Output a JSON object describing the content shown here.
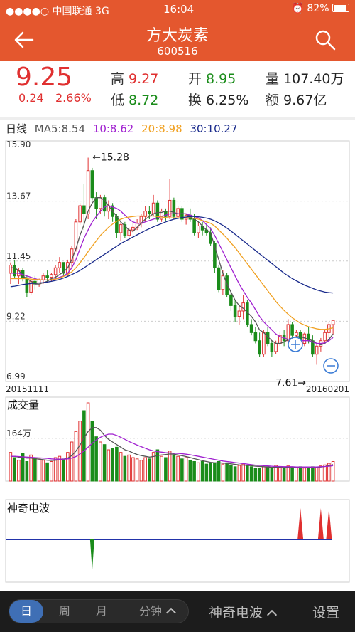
{
  "status": {
    "carrier": "●●●●○ 中国联通",
    "network": "3G",
    "time": "16:04",
    "battery": "82%"
  },
  "nav": {
    "title": "方大炭素",
    "code": "600516"
  },
  "quote": {
    "price": "9.25",
    "change": "0.24",
    "change_pct": "2.66%",
    "high_label": "高",
    "high": "9.27",
    "open_label": "开",
    "open": "8.95",
    "volume_label": "量",
    "volume": "107.40万",
    "low_label": "低",
    "low": "8.72",
    "turnover_label": "换",
    "turnover": "6.25%",
    "amount_label": "额",
    "amount": "9.67亿"
  },
  "ma_bar": {
    "period": "日线",
    "ma5": "MA5:8.54",
    "ma10": "10:8.62",
    "ma20": "20:8.98",
    "ma30": "30:10.27"
  },
  "colors": {
    "accent": "#e4572e",
    "up": "#e03030",
    "down": "#1a8c1a",
    "ma5": "#555555",
    "ma10": "#a020d0",
    "ma20": "#f0a020",
    "ma30": "#1a2b8c",
    "wave": "#2233aa"
  },
  "chart_data": [
    {
      "type": "candlestick",
      "title": "日线",
      "y_ticks": [
        "15.90",
        "13.67",
        "11.45",
        "9.22",
        "6.99"
      ],
      "ylim": [
        6.99,
        15.9
      ],
      "x_start_label": "20151111",
      "x_end_label": "20160201",
      "annotations": [
        {
          "text": "←15.28",
          "value": 15.28
        },
        {
          "text": "7.61→",
          "value": 7.61
        }
      ],
      "candles": [
        [
          11.0,
          11.4,
          10.6,
          11.3
        ],
        [
          11.3,
          11.5,
          10.8,
          10.9
        ],
        [
          10.9,
          11.2,
          10.6,
          11.1
        ],
        [
          11.1,
          11.2,
          10.7,
          10.8
        ],
        [
          10.8,
          10.9,
          10.1,
          10.3
        ],
        [
          10.3,
          10.8,
          10.2,
          10.7
        ],
        [
          10.7,
          10.9,
          10.4,
          10.6
        ],
        [
          10.6,
          10.8,
          10.5,
          10.75
        ],
        [
          10.75,
          11.0,
          10.6,
          10.9
        ],
        [
          10.9,
          11.1,
          10.7,
          10.85
        ],
        [
          10.85,
          11.0,
          10.7,
          10.95
        ],
        [
          10.95,
          11.3,
          10.8,
          11.2
        ],
        [
          11.2,
          11.6,
          11.0,
          11.4
        ],
        [
          11.4,
          11.4,
          10.9,
          11.0
        ],
        [
          11.0,
          11.5,
          10.9,
          11.4
        ],
        [
          11.4,
          12.0,
          11.2,
          11.9
        ],
        [
          11.9,
          13.0,
          11.8,
          12.9
        ],
        [
          12.9,
          13.6,
          12.8,
          13.5
        ],
        [
          13.5,
          14.3,
          12.6,
          13.2
        ],
        [
          13.2,
          15.28,
          13.0,
          14.8
        ],
        [
          14.8,
          14.9,
          13.7,
          13.8
        ],
        [
          13.8,
          14.0,
          13.0,
          13.4
        ],
        [
          13.4,
          13.9,
          13.2,
          13.8
        ],
        [
          13.8,
          13.9,
          13.1,
          13.3
        ],
        [
          13.3,
          13.7,
          13.0,
          13.5
        ],
        [
          13.5,
          13.6,
          12.9,
          13.1
        ],
        [
          13.1,
          13.2,
          12.3,
          12.5
        ],
        [
          12.5,
          12.9,
          12.2,
          12.8
        ],
        [
          12.8,
          12.9,
          12.3,
          12.4
        ],
        [
          12.4,
          12.7,
          12.2,
          12.6
        ],
        [
          12.6,
          12.9,
          12.5,
          12.7
        ],
        [
          12.7,
          13.0,
          12.6,
          12.85
        ],
        [
          12.85,
          13.2,
          12.7,
          13.1
        ],
        [
          13.1,
          13.5,
          12.9,
          13.3
        ],
        [
          13.3,
          13.5,
          13.0,
          13.2
        ],
        [
          13.2,
          13.9,
          13.1,
          13.6
        ],
        [
          13.6,
          13.7,
          12.9,
          13.0
        ],
        [
          13.0,
          13.4,
          12.9,
          13.3
        ],
        [
          13.3,
          13.4,
          12.95,
          13.1
        ],
        [
          13.1,
          14.5,
          13.0,
          13.7
        ],
        [
          13.7,
          13.8,
          13.0,
          13.1
        ],
        [
          13.1,
          13.5,
          13.0,
          13.4
        ],
        [
          13.4,
          13.5,
          12.9,
          13.0
        ],
        [
          13.0,
          13.2,
          12.8,
          13.15
        ],
        [
          13.15,
          13.4,
          12.9,
          13.0
        ],
        [
          13.0,
          13.2,
          12.4,
          12.5
        ],
        [
          12.5,
          12.9,
          12.3,
          12.75
        ],
        [
          12.75,
          12.9,
          12.4,
          12.6
        ],
        [
          12.6,
          12.8,
          12.4,
          12.5
        ],
        [
          12.5,
          12.7,
          12.0,
          12.1
        ],
        [
          12.1,
          12.2,
          11.0,
          11.2
        ],
        [
          11.2,
          11.3,
          10.3,
          10.4
        ],
        [
          10.4,
          11.1,
          10.2,
          10.9
        ],
        [
          10.9,
          11.0,
          10.1,
          10.2
        ],
        [
          10.2,
          10.4,
          9.6,
          9.8
        ],
        [
          9.8,
          10.0,
          9.2,
          9.4
        ],
        [
          9.4,
          9.8,
          9.1,
          9.6
        ],
        [
          9.6,
          10.2,
          9.3,
          9.9
        ],
        [
          9.9,
          10.0,
          9.0,
          9.1
        ],
        [
          9.1,
          9.3,
          8.7,
          8.8
        ],
        [
          8.8,
          9.0,
          8.4,
          8.5
        ],
        [
          8.5,
          8.8,
          7.9,
          8.0
        ],
        [
          8.0,
          8.9,
          7.9,
          8.8
        ],
        [
          8.8,
          9.0,
          8.3,
          8.4
        ],
        [
          8.4,
          8.5,
          7.9,
          8.1
        ],
        [
          8.1,
          8.5,
          8.0,
          8.4
        ],
        [
          8.4,
          8.8,
          8.3,
          8.7
        ],
        [
          8.7,
          8.9,
          8.3,
          8.5
        ],
        [
          8.5,
          9.3,
          8.4,
          9.1
        ],
        [
          9.1,
          9.2,
          8.6,
          8.7
        ],
        [
          8.7,
          8.9,
          8.4,
          8.8
        ],
        [
          8.8,
          8.9,
          8.3,
          8.4
        ],
        [
          8.4,
          8.8,
          8.3,
          8.75
        ],
        [
          8.75,
          9.0,
          8.4,
          8.5
        ],
        [
          8.5,
          8.7,
          7.9,
          8.0
        ],
        [
          8.0,
          8.4,
          7.61,
          8.3
        ],
        [
          8.3,
          8.6,
          8.1,
          8.5
        ],
        [
          8.5,
          8.9,
          8.4,
          8.8
        ],
        [
          8.8,
          9.2,
          8.6,
          9.1
        ],
        [
          9.1,
          9.27,
          8.72,
          9.25
        ]
      ],
      "ma5": [
        11.2,
        11.2,
        11.1,
        10.9,
        10.8,
        10.7,
        10.6,
        10.6,
        10.65,
        10.7,
        10.8,
        10.85,
        10.95,
        11.05,
        11.2,
        11.5,
        11.9,
        12.4,
        12.8,
        13.3,
        13.6,
        13.8,
        13.8,
        13.7,
        13.5,
        13.3,
        13.1,
        12.9,
        12.75,
        12.6,
        12.55,
        12.7,
        12.85,
        13.0,
        13.1,
        13.2,
        13.25,
        13.25,
        13.3,
        13.3,
        13.25,
        13.2,
        13.2,
        13.2,
        13.1,
        13.0,
        12.9,
        12.75,
        12.6,
        12.5,
        12.0,
        11.5,
        11.0,
        10.6,
        10.3,
        10.0,
        9.8,
        9.7,
        9.55,
        9.4,
        9.2,
        8.9,
        8.8,
        8.65,
        8.5,
        8.4,
        8.4,
        8.45,
        8.55,
        8.6,
        8.65,
        8.65,
        8.6,
        8.55,
        8.5,
        8.4,
        8.35,
        8.4,
        8.55,
        8.75
      ],
      "ma10": [
        11.0,
        11.0,
        11.0,
        10.95,
        10.9,
        10.85,
        10.8,
        10.75,
        10.75,
        10.75,
        10.75,
        10.8,
        10.85,
        10.9,
        11.0,
        11.2,
        11.5,
        11.9,
        12.3,
        12.6,
        12.9,
        13.1,
        13.3,
        13.45,
        13.5,
        13.45,
        13.4,
        13.3,
        13.15,
        13.0,
        12.9,
        12.85,
        12.85,
        12.9,
        12.95,
        13.0,
        13.05,
        13.1,
        13.15,
        13.2,
        13.2,
        13.2,
        13.2,
        13.2,
        13.15,
        13.1,
        13.05,
        12.95,
        12.8,
        12.65,
        12.4,
        12.1,
        11.8,
        11.5,
        11.2,
        10.9,
        10.6,
        10.35,
        10.1,
        9.9,
        9.65,
        9.4,
        9.2,
        9.05,
        8.9,
        8.75,
        8.65,
        8.6,
        8.55,
        8.55,
        8.5,
        8.5,
        8.5,
        8.5,
        8.45,
        8.4,
        8.4,
        8.42,
        8.5,
        8.62
      ],
      "ma20": [
        10.8,
        10.8,
        10.8,
        10.8,
        10.8,
        10.78,
        10.77,
        10.76,
        10.75,
        10.75,
        10.76,
        10.78,
        10.82,
        10.88,
        10.95,
        11.05,
        11.2,
        11.38,
        11.58,
        11.8,
        12.0,
        12.2,
        12.4,
        12.55,
        12.7,
        12.82,
        12.92,
        13.0,
        13.05,
        13.08,
        13.1,
        13.12,
        13.12,
        13.12,
        13.12,
        13.12,
        13.1,
        13.08,
        13.06,
        13.05,
        13.05,
        13.05,
        13.05,
        13.05,
        13.05,
        13.03,
        13.0,
        12.95,
        12.9,
        12.85,
        12.75,
        12.6,
        12.45,
        12.3,
        12.12,
        11.95,
        11.75,
        11.55,
        11.35,
        11.15,
        10.95,
        10.75,
        10.55,
        10.35,
        10.15,
        9.95,
        9.78,
        9.62,
        9.48,
        9.35,
        9.25,
        9.15,
        9.08,
        9.02,
        8.98,
        8.94,
        8.92,
        8.92,
        8.94,
        8.98
      ],
      "ma30": [
        10.5,
        10.52,
        10.55,
        10.58,
        10.6,
        10.62,
        10.63,
        10.64,
        10.65,
        10.67,
        10.7,
        10.73,
        10.77,
        10.82,
        10.88,
        10.95,
        11.02,
        11.1,
        11.2,
        11.3,
        11.4,
        11.5,
        11.6,
        11.7,
        11.8,
        11.9,
        12.0,
        12.1,
        12.18,
        12.26,
        12.34,
        12.42,
        12.5,
        12.58,
        12.65,
        12.72,
        12.78,
        12.84,
        12.9,
        12.95,
        13.0,
        13.03,
        13.06,
        13.08,
        13.1,
        13.1,
        13.09,
        13.07,
        13.04,
        13.0,
        12.94,
        12.86,
        12.77,
        12.67,
        12.56,
        12.44,
        12.32,
        12.2,
        12.08,
        11.96,
        11.84,
        11.72,
        11.6,
        11.48,
        11.36,
        11.24,
        11.12,
        11.0,
        10.9,
        10.8,
        10.72,
        10.64,
        10.56,
        10.5,
        10.44,
        10.38,
        10.34,
        10.3,
        10.28,
        10.27
      ]
    },
    {
      "type": "bar",
      "title": "成交量",
      "y_tick": "164万",
      "y_tick_value": 164,
      "ylim": [
        0,
        300
      ],
      "values": [
        110,
        90,
        80,
        105,
        75,
        100,
        90,
        85,
        80,
        70,
        75,
        90,
        95,
        85,
        110,
        150,
        190,
        230,
        270,
        300,
        230,
        170,
        150,
        140,
        120,
        125,
        130,
        110,
        95,
        100,
        90,
        85,
        80,
        90,
        85,
        110,
        120,
        95,
        90,
        115,
        100,
        95,
        85,
        90,
        80,
        75,
        70,
        75,
        65,
        70,
        70,
        75,
        65,
        70,
        60,
        55,
        60,
        65,
        60,
        55,
        50,
        50,
        55,
        55,
        50,
        60,
        55,
        50,
        58,
        50,
        52,
        55,
        50,
        48,
        55,
        52,
        58,
        62,
        68,
        75
      ],
      "ma5": [
        95,
        95,
        92,
        90,
        88,
        88,
        86,
        84,
        82,
        80,
        79,
        80,
        82,
        84,
        88,
        98,
        115,
        138,
        165,
        190,
        205,
        205,
        195,
        175,
        160,
        150,
        140,
        130,
        120,
        115,
        108,
        102,
        98,
        95,
        92,
        94,
        98,
        100,
        102,
        104,
        103,
        100,
        97,
        94,
        90,
        86,
        82,
        78,
        75,
        72,
        70,
        70,
        69,
        68,
        66,
        64,
        62,
        61,
        60,
        59,
        57,
        56,
        55,
        54,
        53,
        53,
        53,
        52,
        52,
        52,
        52,
        51,
        51,
        51,
        52,
        53,
        54,
        56,
        59,
        63
      ],
      "ma10": [
        95,
        95,
        94,
        93,
        92,
        91,
        90,
        89,
        88,
        87,
        85,
        84,
        84,
        84,
        85,
        88,
        94,
        104,
        116,
        130,
        145,
        158,
        168,
        175,
        180,
        180,
        175,
        168,
        160,
        152,
        145,
        138,
        132,
        126,
        120,
        116,
        113,
        111,
        109,
        108,
        107,
        106,
        105,
        103,
        101,
        98,
        95,
        92,
        89,
        86,
        83,
        80,
        77,
        75,
        73,
        71,
        69,
        67,
        65,
        63,
        61,
        60,
        59,
        58,
        57,
        56,
        56,
        55,
        55,
        55,
        54,
        54,
        54,
        54,
        54,
        54,
        55,
        56,
        57,
        59
      ]
    },
    {
      "type": "bar",
      "title": "神奇电波",
      "series": [
        {
          "x": [
            71
          ],
          "values": [
            1
          ]
        },
        {
          "x": [
            76
          ],
          "values": [
            1
          ]
        },
        {
          "x": [
            78
          ],
          "values": [
            1
          ]
        },
        {
          "x": [
            20
          ],
          "values": [
            -1
          ]
        }
      ]
    }
  ],
  "bottom": {
    "tabs": [
      "日",
      "周",
      "月",
      "分钟"
    ],
    "active": 0,
    "indicator": "神奇电波",
    "settings": "设置"
  }
}
